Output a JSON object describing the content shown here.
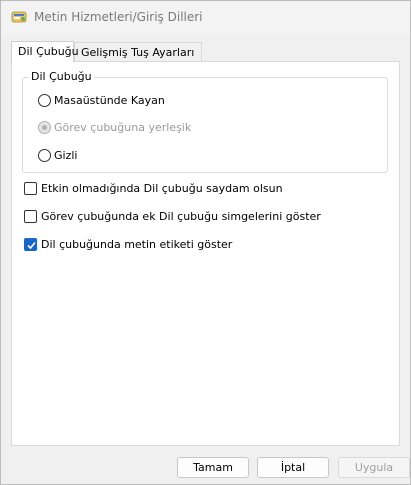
{
  "window": {
    "title": "Metin Hizmetleri/Giriş Dilleri",
    "icon": "language-settings-icon"
  },
  "tabs": [
    {
      "label": "Dil Çubuğu",
      "active": true
    },
    {
      "label": "Gelişmiş Tuş Ayarları",
      "active": false
    }
  ],
  "language_bar_group": {
    "legend": "Dil Çubuğu",
    "options": [
      {
        "label": "Masaüstünde Kayan",
        "selected": false,
        "enabled": true
      },
      {
        "label": "Görev çubuğuna yerleşik",
        "selected": true,
        "enabled": false
      },
      {
        "label": "Gizli",
        "selected": false,
        "enabled": true
      }
    ]
  },
  "checkboxes": [
    {
      "label": "Etkin olmadığında Dil çubuğu saydam olsun",
      "checked": false
    },
    {
      "label": "Görev çubuğunda ek Dil çubuğu simgelerini göster",
      "checked": false
    },
    {
      "label": "Dil çubuğunda metin etiketi göster",
      "checked": true
    }
  ],
  "buttons": {
    "ok": "Tamam",
    "cancel": "İptal",
    "apply": "Uygula"
  },
  "colors": {
    "accent": "#1a65c9"
  }
}
